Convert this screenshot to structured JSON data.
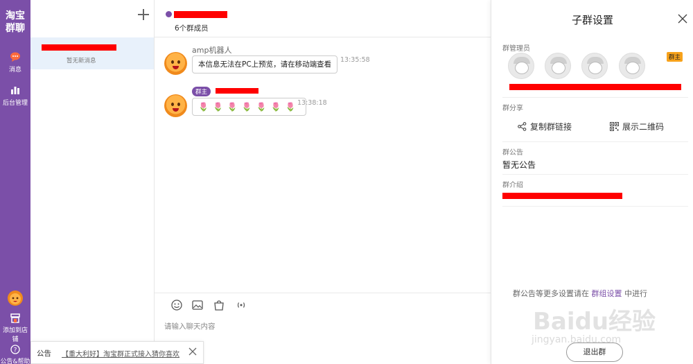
{
  "sidebar": {
    "logo": "淘宝群聊",
    "items": [
      {
        "label": "消息",
        "icon": "chat-bubble-icon"
      },
      {
        "label": "后台管理",
        "icon": "bar-chart-icon"
      },
      {
        "label": "添加到店铺",
        "icon": "store-icon"
      },
      {
        "label": "公告&帮助",
        "icon": "help-icon"
      }
    ]
  },
  "conversations": [
    {
      "preview": "暂无新消息",
      "selected": true
    }
  ],
  "chat": {
    "member_count": "6个群成员",
    "messages": [
      {
        "sender": "amp机器人",
        "text": "本信息无法在PC上预览，请在移动端查看",
        "time": "13:35:58"
      },
      {
        "role_tag": "群主",
        "text": "🌷🌷🌷🌷🌷🌷🌷",
        "time": "13:38:18"
      }
    ],
    "input_placeholder": "请输入聊天内容",
    "tools": [
      "emoji-icon",
      "image-icon",
      "shopping-bag-icon",
      "audio-icon"
    ]
  },
  "notice": {
    "label": "公告",
    "text": "【重大利好】淘宝群正式接入猜你喜欢"
  },
  "panel": {
    "title": "子群设置",
    "admins_label": "群管理员",
    "owner_badge": "群主",
    "share_label": "群分享",
    "copy_link": "复制群链接",
    "show_qr": "展示二维码",
    "announcement_label": "群公告",
    "announcement_value": "暂无公告",
    "intro_label": "群介绍",
    "hint_prefix": "群公告等更多设置请在 ",
    "hint_link": "群组设置",
    "hint_suffix": " 中进行",
    "exit_button": "退出群",
    "watermark": "Baidu经验",
    "watermark_sub": "jingyan.baidu.com"
  },
  "colors": {
    "brand_purple": "#7b4fa8",
    "selected_row": "#e8f1fb",
    "owner_badge": "#f7a21b"
  }
}
